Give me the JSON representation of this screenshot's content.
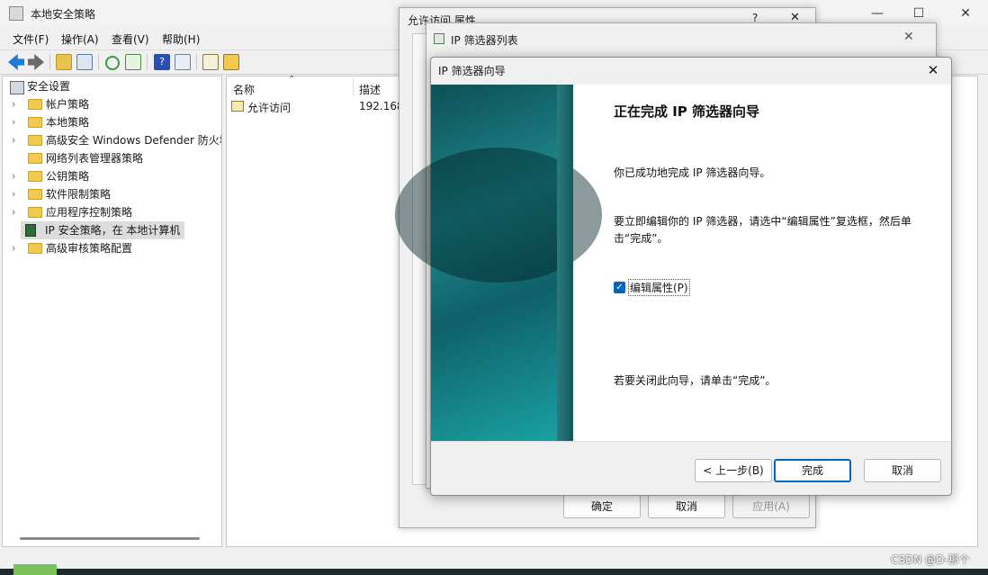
{
  "main": {
    "title": "本地安全策略",
    "controls": {
      "minimize": "—",
      "maximize": "☐",
      "close": "✕"
    },
    "menu": [
      "文件(F)",
      "操作(A)",
      "查看(V)",
      "帮助(H)"
    ],
    "tree": {
      "root": "安全设置",
      "items": [
        {
          "label": "帐户策略",
          "chev": "›"
        },
        {
          "label": "本地策略",
          "chev": "›"
        },
        {
          "label": "高级安全 Windows Defender 防火墙",
          "chev": "›"
        },
        {
          "label": "网络列表管理器策略",
          "chev": ""
        },
        {
          "label": "公钥策略",
          "chev": "›"
        },
        {
          "label": "软件限制策略",
          "chev": "›"
        },
        {
          "label": "应用程序控制策略",
          "chev": "›"
        },
        {
          "label": "IP 安全策略，在 本地计算机",
          "chev": ""
        },
        {
          "label": "高级审核策略配置",
          "chev": "›"
        }
      ]
    },
    "list": {
      "columns": [
        "名称",
        "描述"
      ],
      "rows": [
        {
          "name": "允许访问",
          "desc": "192.168"
        }
      ]
    }
  },
  "dialog_properties": {
    "title": "允许访问 属性",
    "help": "?",
    "close": "✕",
    "buttons": {
      "ok": "确定",
      "cancel": "取消",
      "apply": "应用(A)"
    }
  },
  "dialog_filter_list": {
    "title": "IP 筛选器列表",
    "close": "✕"
  },
  "wizard": {
    "title": "IP 筛选器向导",
    "close": "✕",
    "heading": "正在完成 IP 筛选器向导",
    "text1": "你已成功地完成 IP 筛选器向导。",
    "text2": "要立即编辑你的 IP 筛选器，请选中“编辑属性”复选框，然后单击“完成”。",
    "checkbox_mark": "✓",
    "checkbox_label": "编辑属性(P)",
    "text3": "若要关闭此向导，请单击“完成”。",
    "buttons": {
      "back": "< 上一步(B)",
      "finish": "完成",
      "cancel": "取消"
    }
  },
  "watermark": "CSDN @D-那个"
}
